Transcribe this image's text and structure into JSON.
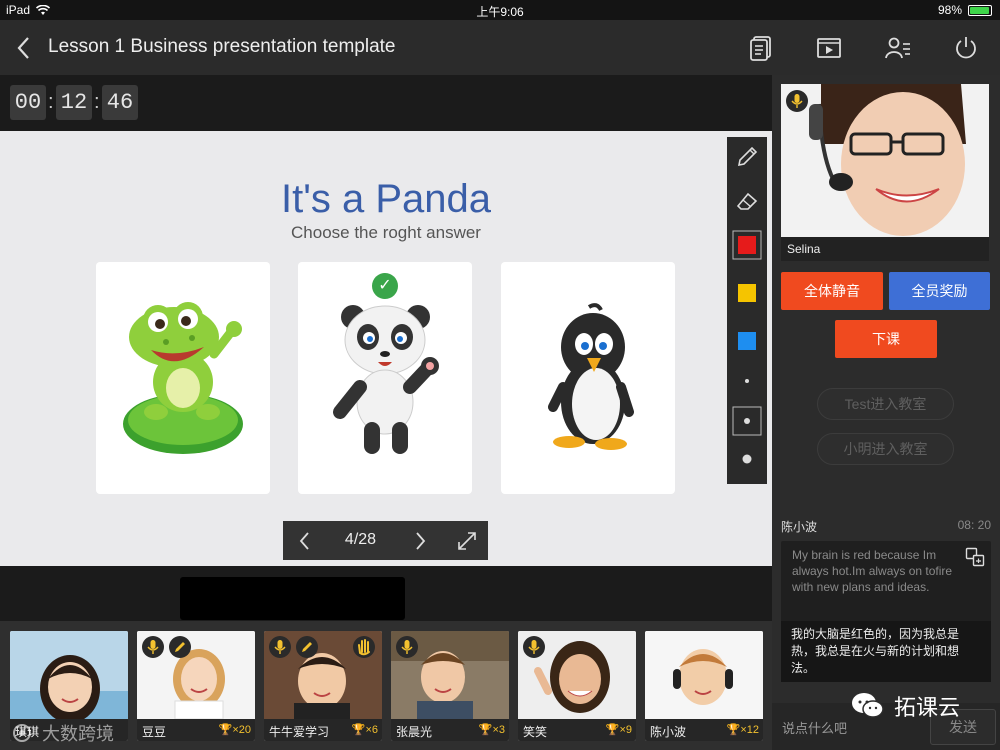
{
  "status": {
    "device": "iPad",
    "time": "上午9:06",
    "battery": "98%",
    "battery_level": 0.98
  },
  "header": {
    "title": "Lesson 1 Business presentation template"
  },
  "timer": {
    "h": "00",
    "m": "12",
    "s": "46"
  },
  "slide": {
    "title": "It's a Panda",
    "subtitle": "Choose the roght answer",
    "cards": [
      {
        "animal": "frog",
        "correct": false
      },
      {
        "animal": "panda",
        "correct": true
      },
      {
        "animal": "penguin",
        "correct": false
      }
    ],
    "pager": "4/28"
  },
  "tools": {
    "colors": [
      "#e61b1b",
      "#f5c400",
      "#1e8ef0"
    ]
  },
  "teacher": {
    "name": "Selina"
  },
  "actions": {
    "mute_all": "全体静音",
    "reward_all": "全员奖励",
    "end_class": "下课",
    "join1": "Test进入教室",
    "join2": "小明进入教室"
  },
  "chat": {
    "name": "陈小波",
    "time": "08: 20",
    "en": "My brain is red because Im always hot.Im always on tofire with new plans and ideas.",
    "zh": "我的大脑是红色的，因为我总是热，我总是在火与新的计划和想法。",
    "placeholder": "说点什么吧",
    "send": "发送"
  },
  "students": [
    {
      "name": "琪琪",
      "score": ""
    },
    {
      "name": "豆豆",
      "score": "×20"
    },
    {
      "name": "牛牛爱学习",
      "score": "×6"
    },
    {
      "name": "张晨光",
      "score": "×3"
    },
    {
      "name": "笑笑",
      "score": "×9"
    },
    {
      "name": "陈小波",
      "score": "×12"
    }
  ],
  "watermarks": {
    "left": "大数跨境",
    "right": "拓课云"
  }
}
